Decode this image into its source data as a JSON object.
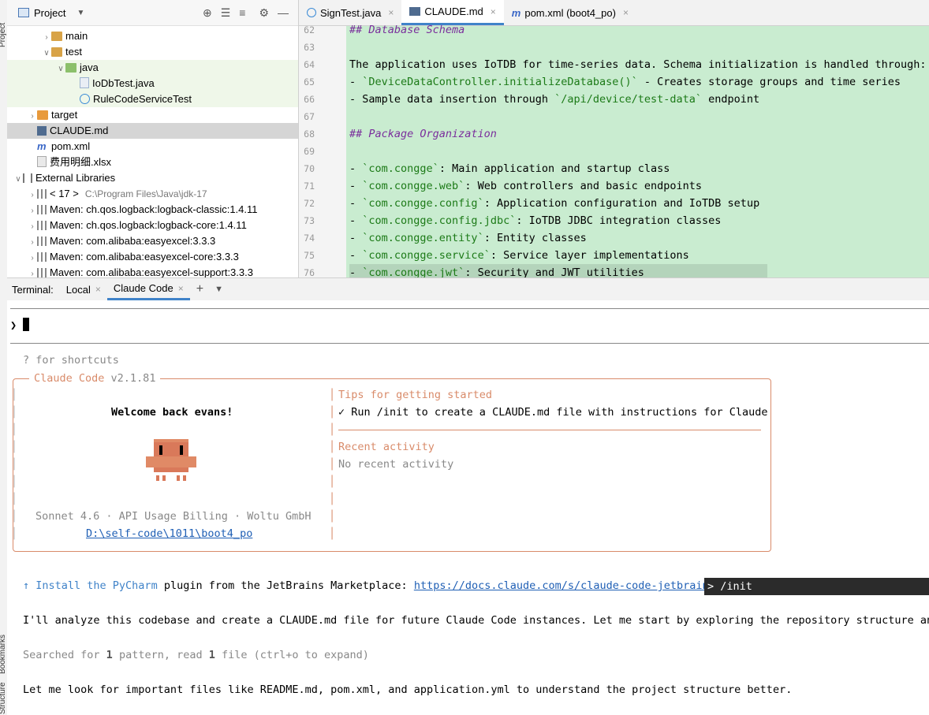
{
  "project_panel": {
    "title": "Project",
    "side_label": "Project",
    "tree": [
      {
        "label": "main",
        "depth": 2,
        "expanded": false,
        "icon": "folder-icon"
      },
      {
        "label": "test",
        "depth": 2,
        "expanded": true,
        "icon": "folder-icon"
      },
      {
        "label": "java",
        "depth": 3,
        "expanded": true,
        "icon": "folder-test-icon"
      },
      {
        "label": "IoDbTest.java",
        "depth": 4,
        "icon": "java-file-icon"
      },
      {
        "label": "RuleCodeServiceTest",
        "depth": 4,
        "icon": "java-class-icon"
      },
      {
        "label": "target",
        "depth": 1,
        "expanded": false,
        "icon": "folder-excluded-icon"
      },
      {
        "label": "CLAUDE.md",
        "depth": 1,
        "icon": "markdown-file-icon",
        "selected": true
      },
      {
        "label": "pom.xml",
        "depth": 1,
        "icon": "maven-file-icon"
      },
      {
        "label": "费用明细.xlsx",
        "depth": 1,
        "icon": "excel-file-icon"
      },
      {
        "label": "External Libraries",
        "depth": 0,
        "expanded": true,
        "icon": "libraries-icon"
      },
      {
        "label": "< 17 >",
        "extra": "C:\\Program Files\\Java\\jdk-17",
        "depth": 1,
        "expanded": false,
        "icon": "jdk-icon"
      },
      {
        "label": "Maven: ch.qos.logback:logback-classic:1.4.11",
        "depth": 1,
        "expanded": false,
        "icon": "library-icon"
      },
      {
        "label": "Maven: ch.qos.logback:logback-core:1.4.11",
        "depth": 1,
        "expanded": false,
        "icon": "library-icon"
      },
      {
        "label": "Maven: com.alibaba:easyexcel:3.3.3",
        "depth": 1,
        "expanded": false,
        "icon": "library-icon"
      },
      {
        "label": "Maven: com.alibaba:easyexcel-core:3.3.3",
        "depth": 1,
        "expanded": false,
        "icon": "library-icon"
      },
      {
        "label": "Maven: com.alibaba:easyexcel-support:3.3.3",
        "depth": 1,
        "expanded": false,
        "icon": "library-icon"
      }
    ]
  },
  "editor": {
    "tabs": [
      {
        "label": "SignTest.java",
        "icon": "java-class-icon",
        "active": false
      },
      {
        "label": "CLAUDE.md",
        "icon": "markdown-file-icon",
        "active": true
      },
      {
        "label": "pom.xml (boot4_po)",
        "icon": "maven-file-icon",
        "active": false
      }
    ],
    "lines": [
      {
        "n": "62",
        "segs": [
          {
            "t": "## Database Schema",
            "c": "hd"
          }
        ]
      },
      {
        "n": "63",
        "segs": []
      },
      {
        "n": "64",
        "segs": [
          {
            "t": "The application uses IoTDB for time-series data. Schema initialization is handled through:"
          }
        ]
      },
      {
        "n": "65",
        "segs": [
          {
            "t": "- "
          },
          {
            "t": "`DeviceDataController.initializeDatabase()`",
            "c": "cd"
          },
          {
            "t": " - Creates storage groups and time series"
          }
        ]
      },
      {
        "n": "66",
        "segs": [
          {
            "t": "- Sample data insertion through "
          },
          {
            "t": "`/api/device/test-data`",
            "c": "cd"
          },
          {
            "t": " endpoint"
          }
        ]
      },
      {
        "n": "67",
        "segs": []
      },
      {
        "n": "68",
        "segs": [
          {
            "t": "## Package Organization",
            "c": "hd"
          }
        ]
      },
      {
        "n": "69",
        "segs": []
      },
      {
        "n": "70",
        "segs": [
          {
            "t": "- "
          },
          {
            "t": "`com.congge`",
            "c": "cd"
          },
          {
            "t": ": Main application and startup class"
          }
        ]
      },
      {
        "n": "71",
        "segs": [
          {
            "t": "- "
          },
          {
            "t": "`com.congge.web`",
            "c": "cd"
          },
          {
            "t": ": Web controllers and basic endpoints"
          }
        ]
      },
      {
        "n": "72",
        "segs": [
          {
            "t": "- "
          },
          {
            "t": "`com.congge.config`",
            "c": "cd"
          },
          {
            "t": ": Application configuration and IoTDB setup"
          }
        ]
      },
      {
        "n": "73",
        "segs": [
          {
            "t": "- "
          },
          {
            "t": "`com.congge.config.jdbc`",
            "c": "cd"
          },
          {
            "t": ": IoTDB JDBC integration classes"
          }
        ]
      },
      {
        "n": "74",
        "segs": [
          {
            "t": "- "
          },
          {
            "t": "`com.congge.entity`",
            "c": "cd"
          },
          {
            "t": ": Entity classes"
          }
        ]
      },
      {
        "n": "75",
        "segs": [
          {
            "t": "- "
          },
          {
            "t": "`com.congge.service`",
            "c": "cd"
          },
          {
            "t": ": Service layer implementations"
          }
        ]
      },
      {
        "n": "76",
        "segs": [
          {
            "t": "- "
          },
          {
            "t": "`com.congge.jwt`",
            "c": "cd"
          },
          {
            "t": ": Security and JWT utilities"
          }
        ]
      }
    ]
  },
  "terminal": {
    "label": "Terminal:",
    "tabs": [
      {
        "label": "Local",
        "active": false
      },
      {
        "label": "Claude Code",
        "active": true
      }
    ],
    "prompt": "❯",
    "shortcuts_hint": "? for shortcuts",
    "box_title_app": "Claude Code",
    "box_title_version": "v2.1.81",
    "welcome": "Welcome back evans!",
    "model_info": "Sonnet 4.6 · API Usage Billing · Woltu GmbH",
    "cwd": "D:\\self-code\\1011\\boot4_po",
    "tips_heading": "Tips for getting started",
    "tip_item": "✓ Run /init to create a CLAUDE.md file with instructions for Claude",
    "recent_heading": "Recent activity",
    "recent_text": "No recent activity",
    "install_pre": "↑ Install the ",
    "install_product": "PyCharm",
    "install_mid": " plugin from the JetBrains Marketplace: ",
    "install_link": "https://docs.claude.com/s/claude-code-jetbrains",
    "init_cmd": "> /init",
    "analyze_msg": "I'll analyze this codebase and create a CLAUDE.md file for future Claude Code instances. Let me start by exploring the repository structure and",
    "search_pre": "Searched for ",
    "search_n1": "1",
    "search_mid": " pattern, read ",
    "search_n2": "1",
    "search_post": " file (ctrl+o to expand)",
    "look_msg": "Let me look for important files like README.md, pom.xml, and application.yml to understand the project structure better."
  },
  "side_labels": {
    "bookmarks": "Bookmarks",
    "structure": "Structure"
  },
  "colors": {
    "accent": "#4083c9",
    "claude_orange": "#d98b6a",
    "editor_green": "#c9ecd0",
    "heading_purple": "#7a2e9c",
    "code_green": "#1c7a17"
  }
}
